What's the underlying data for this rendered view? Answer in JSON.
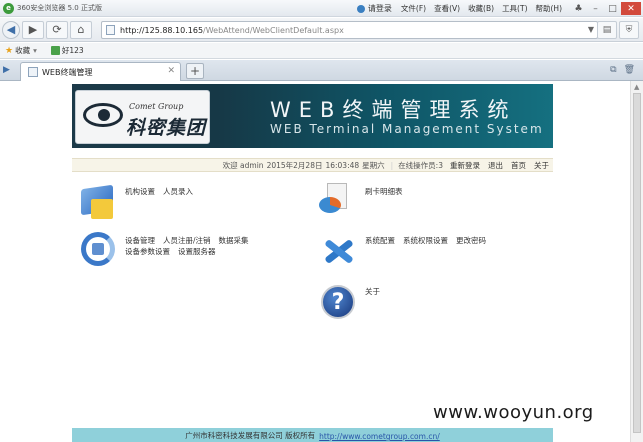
{
  "browser": {
    "title": "360安全浏览器 5.0 正式版",
    "login": "请登录",
    "menu": [
      "文件(F)",
      "查看(V)",
      "收藏(B)",
      "工具(T)",
      "帮助(H)"
    ],
    "address": {
      "host": "http://125.88.10.165",
      "path": "/WebAttend/WebClientDefault.aspx"
    },
    "favorites": {
      "label": "收藏",
      "hao": "好123"
    },
    "tab": {
      "label": "WEB终端管理"
    }
  },
  "header": {
    "logo_en": "Comet Group",
    "logo_cn": "科密集团",
    "title_cn": "WEB终端管理系统",
    "title_en": "WEB Terminal Management System"
  },
  "infobar": {
    "welcome": "欢迎 admin",
    "date": "2015年2月28日",
    "time": "16:03:48",
    "weekday": "星期六",
    "operators": "在线操作员:3",
    "relogin": "重新登录",
    "logout": "退出",
    "home": "首页",
    "about": "关于"
  },
  "modules": {
    "org": [
      "机构设置",
      "人员录入"
    ],
    "card": [
      "刷卡明细表"
    ],
    "device_line1": [
      "设备管理",
      "人员注册/注销",
      "数据采集"
    ],
    "device_line2": [
      "设备参数设置",
      "设置服务器"
    ],
    "system": [
      "系统配置",
      "系统权限设置",
      "更改密码"
    ],
    "help": [
      "关于"
    ]
  },
  "footer": {
    "text": "广州市科密科技发展有限公司  版权所有",
    "url": "http://www.cometgroup.com.cn/"
  },
  "watermark": "www.wooyun.org"
}
